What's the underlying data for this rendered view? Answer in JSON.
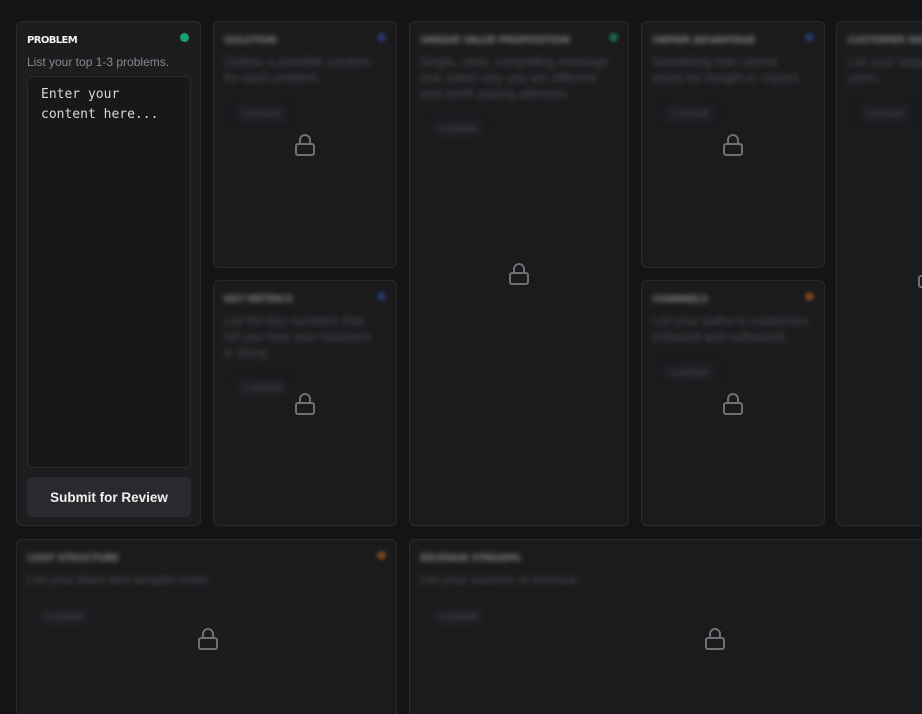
{
  "problem_card": {
    "title": "Problem",
    "description": "List your top 1-3 problems.",
    "status_color": "#17a36b",
    "textarea_placeholder": "Enter your\ncontent here...",
    "submit_label": "Submit for Review"
  },
  "locked_cards": {
    "solution": {
      "title": "Solution",
      "description": "Outline a possible solution for each problem.",
      "chip": "Locked",
      "status_color": "#2d4a9e"
    },
    "key_metrics": {
      "title": "Key Metrics",
      "description": "List the key numbers that tell you how your business is doing.",
      "chip": "Locked",
      "status_color": "#2d4a9e"
    },
    "unique_value_proposition": {
      "title": "Unique Value Proposition",
      "description": "Single, clear, compelling message that states why you are different and worth paying attention.",
      "chip": "Locked",
      "status_color": "#17a36b"
    },
    "unfair_advantage": {
      "title": "Unfair Advantage",
      "description": "Something that cannot easily be bought or copied.",
      "chip": "Locked",
      "status_color": "#2d4a9e"
    },
    "channels": {
      "title": "Channels",
      "description": "List your paths to customers (inbound and outbound).",
      "chip": "Locked",
      "status_color": "#b8641e"
    },
    "customer_segments": {
      "title": "Customer Segments",
      "description": "List your target customers and users.",
      "chip": "Locked"
    },
    "cost_structure": {
      "title": "Cost Structure",
      "description": "List your fixed and variable costs.",
      "chip": "Locked",
      "status_color": "#b8641e"
    },
    "revenue_streams": {
      "title": "Revenue Streams",
      "description": "List your sources of revenue.",
      "chip": "Locked"
    }
  },
  "icons": {
    "lock": "lock-icon",
    "status": "status-dot"
  },
  "colors": {
    "background": "#141416",
    "card": "#1b1b1e",
    "card_border": "#2a2a2e",
    "lock_stroke": "#6f6f74",
    "button": "#2a2a2e"
  }
}
